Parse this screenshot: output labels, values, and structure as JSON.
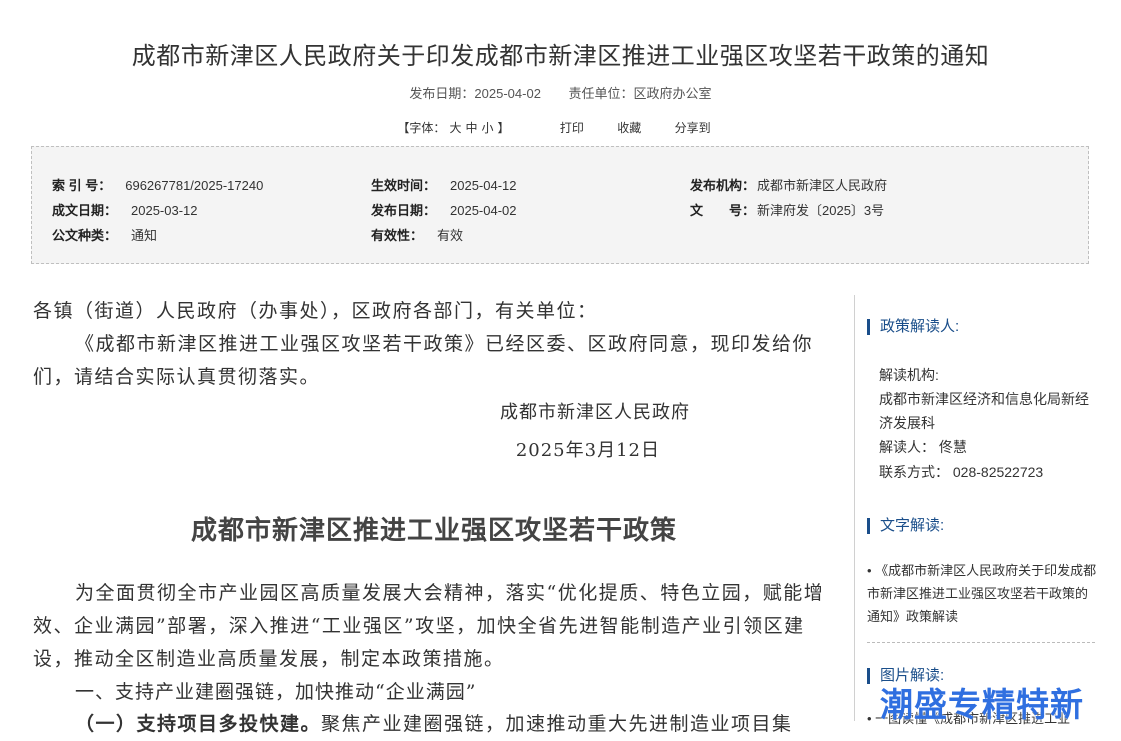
{
  "title": "成都市新津区人民政府关于印发成都市新津区推进工业强区攻坚若干政策的通知",
  "meta": {
    "publish_date": "发布日期：2025-04-02",
    "unit": "责任单位：区政府办公室"
  },
  "tools": {
    "font_label": "【字体：",
    "font_large": "大",
    "font_medium": "中",
    "font_small": "小",
    "font_end": "】",
    "print": "打印",
    "favorite": "收藏",
    "share": "分享到"
  },
  "info": {
    "index_label": "索 引 号：",
    "index_value": "696267781/2025-17240",
    "effective_label": "生效时间：",
    "effective_value": "2025-04-12",
    "issuer_label": "发布机构：",
    "issuer_value": "成都市新津区人民政府",
    "written_label": "成文日期：",
    "written_value": "2025-03-12",
    "pubdate_label": "发布日期：",
    "pubdate_value": "2025-04-02",
    "docno_label": "文　　号：",
    "docno_value": "新津府发〔2025〕3号",
    "type_label": "公文种类：",
    "type_value": "通知",
    "validity_label": "有效性：",
    "validity_value": "有效"
  },
  "body": {
    "salutation": "各镇（街道）人民政府（办事处），区政府各部门，有关单位：",
    "para1": "《成都市新津区推进工业强区攻坚若干政策》已经区委、区政府同意，现印发给你们，请结合实际认真贯彻落实。",
    "sign_org": "成都市新津区人民政府",
    "sign_date": "2025年3月12日",
    "doc_title": "成都市新津区推进工业强区攻坚若干政策",
    "para2": "为全面贯彻全市产业园区高质量发展大会精神，落实“优化提质、特色立园，赋能增效、企业满园”部署，深入推进“工业强区”攻坚，加快全省先进智能制造产业引领区建设，推动全区制造业高质量发展，制定本政策措施。",
    "section1": "一、支持产业建圈强链，加快推动“企业满园”",
    "sub1_bold": "（一）支持项目多投快建。",
    "sub1_text": "聚焦产业建圈强链，加速推动重大先进制造业项目集"
  },
  "sidebar": {
    "policy_head": "政策解读人:",
    "org_label": "解读机构:",
    "org_value": "成都市新津区经济和信息化局新经济发展科",
    "person": "解读人：  佟慧",
    "contact": "联系方式：  028-82522723",
    "text_head": "文字解读:",
    "text_link": "《成都市新津区人民政府关于印发成都市新津区推进工业强区攻坚若干政策的通知》政策解读",
    "image_head": "图片解读:",
    "image_link": "一图读懂《成都市新津区推进工业"
  },
  "watermark": "潮盛专精特新"
}
